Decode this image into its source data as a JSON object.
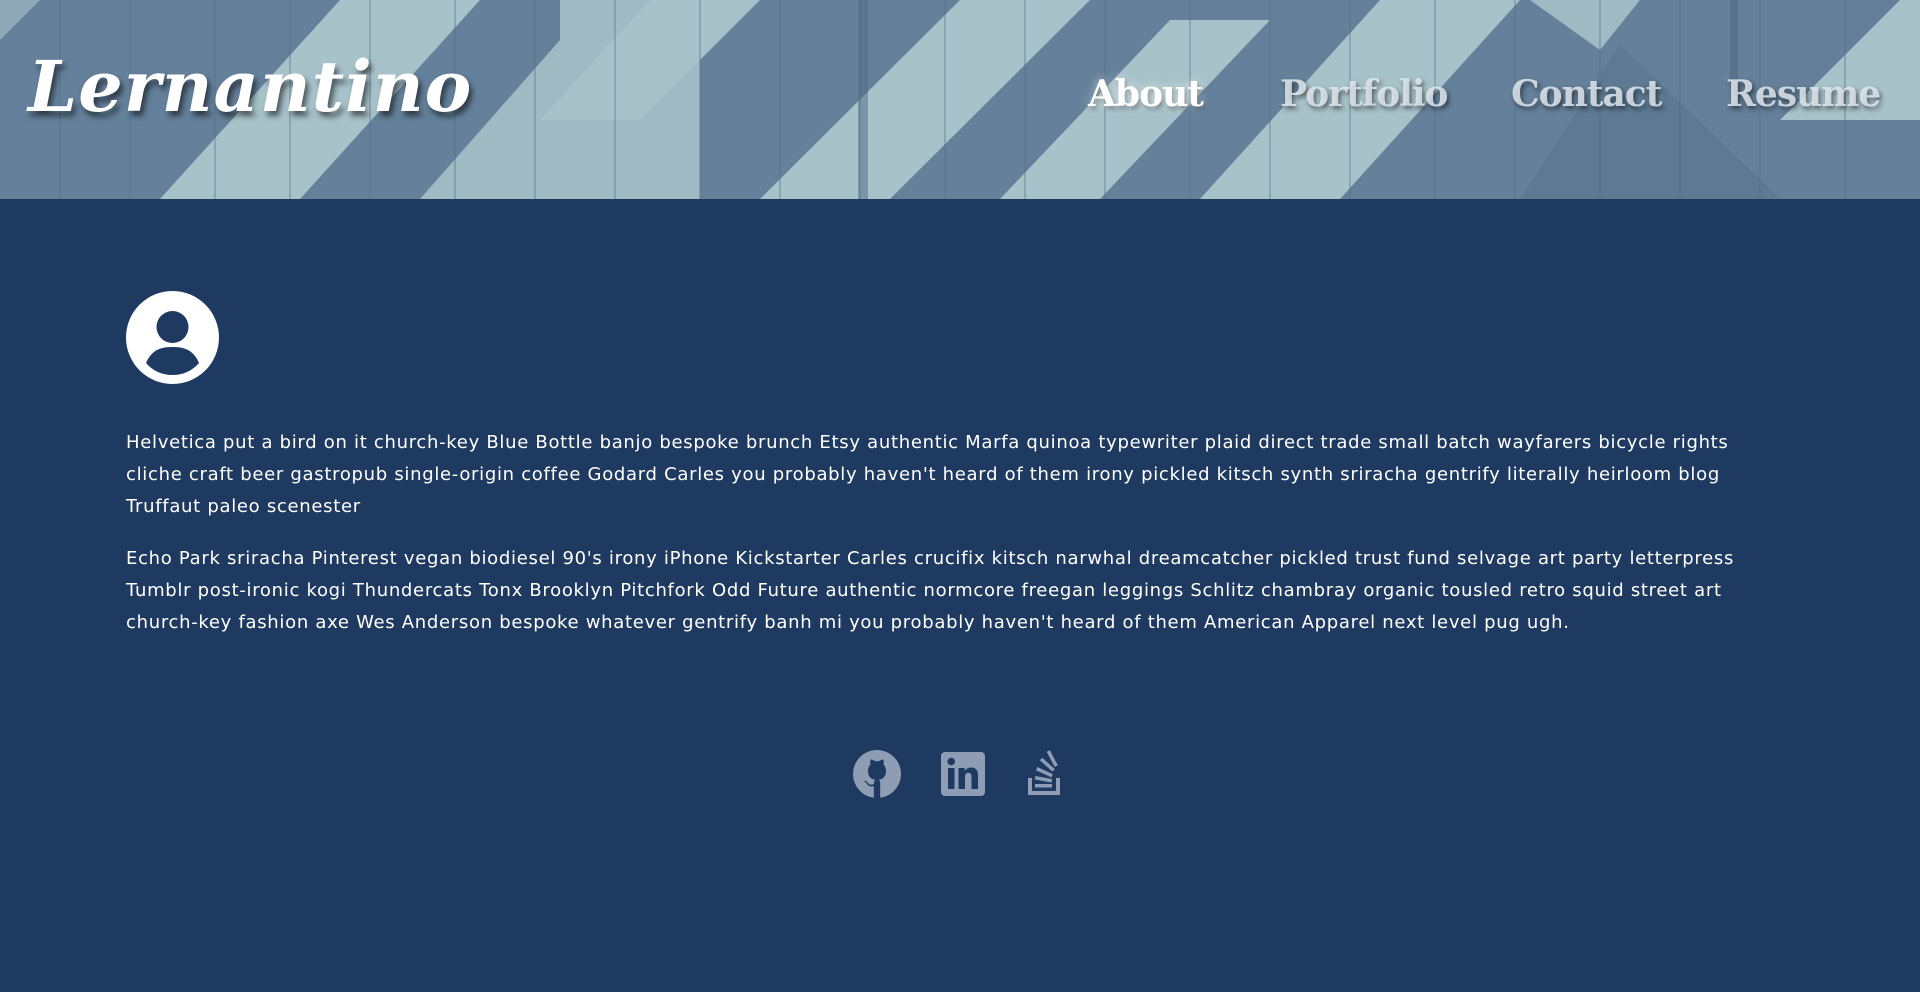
{
  "site": {
    "logo": "Lernantino"
  },
  "nav": {
    "items": [
      {
        "label": "About",
        "active": true
      },
      {
        "label": "Portfolio",
        "active": false
      },
      {
        "label": "Contact",
        "active": false
      },
      {
        "label": "Resume",
        "active": false
      }
    ]
  },
  "about": {
    "avatar_icon": "user-circle-icon",
    "paragraphs": [
      "Helvetica put a bird on it church-key Blue Bottle banjo bespoke brunch Etsy authentic Marfa quinoa typewriter plaid direct trade small batch wayfarers bicycle rights cliche craft beer gastropub single-origin coffee Godard Carles you probably haven't heard of them irony pickled kitsch synth sriracha gentrify literally heirloom blog Truffaut paleo scenester",
      "Echo Park sriracha Pinterest vegan biodiesel 90's irony iPhone Kickstarter Carles crucifix kitsch narwhal dreamcatcher pickled trust fund selvage art party letterpress Tumblr post-ironic kogi Thundercats Tonx Brooklyn Pitchfork Odd Future authentic normcore freegan leggings Schlitz chambray organic tousled retro squid street art church-key fashion axe Wes Anderson bespoke whatever gentrify banh mi you probably haven't heard of them American Apparel next level pug ugh."
    ]
  },
  "social": {
    "icons": [
      "github-icon",
      "linkedin-icon",
      "stackoverflow-icon"
    ]
  },
  "colors": {
    "background": "#1f3a61",
    "header_light": "#a7c2c9",
    "header_dark": "#64809a",
    "text": "#ffffff",
    "icon": "#8e9db3"
  }
}
